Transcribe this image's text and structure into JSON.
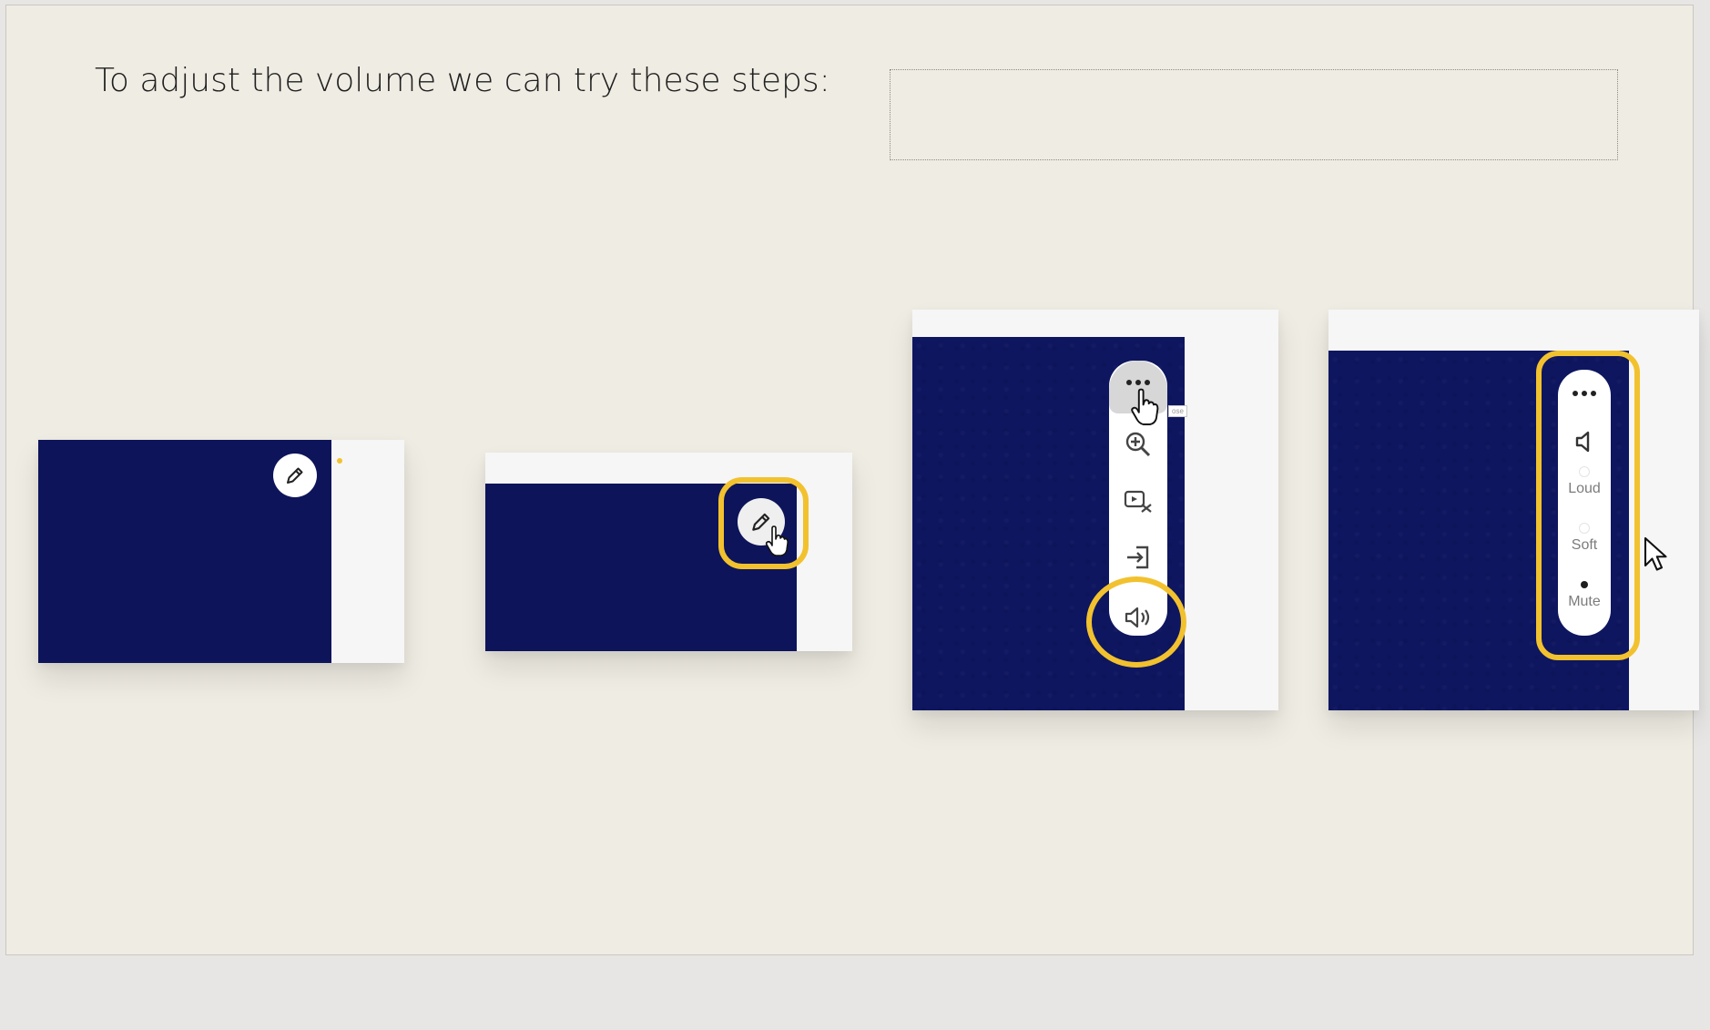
{
  "slide": {
    "title": "To adjust the volume we can try these steps:"
  },
  "step3": {
    "tooltip": "ose"
  },
  "step4": {
    "volume_options": [
      {
        "label": "Loud",
        "selected": false
      },
      {
        "label": "Soft",
        "selected": false
      },
      {
        "label": "Mute",
        "selected": true
      }
    ]
  },
  "colors": {
    "slide_background": "#efece3",
    "navy": "#0d145a",
    "highlight": "#f2c12e",
    "app_background": "#e7e6e4"
  }
}
